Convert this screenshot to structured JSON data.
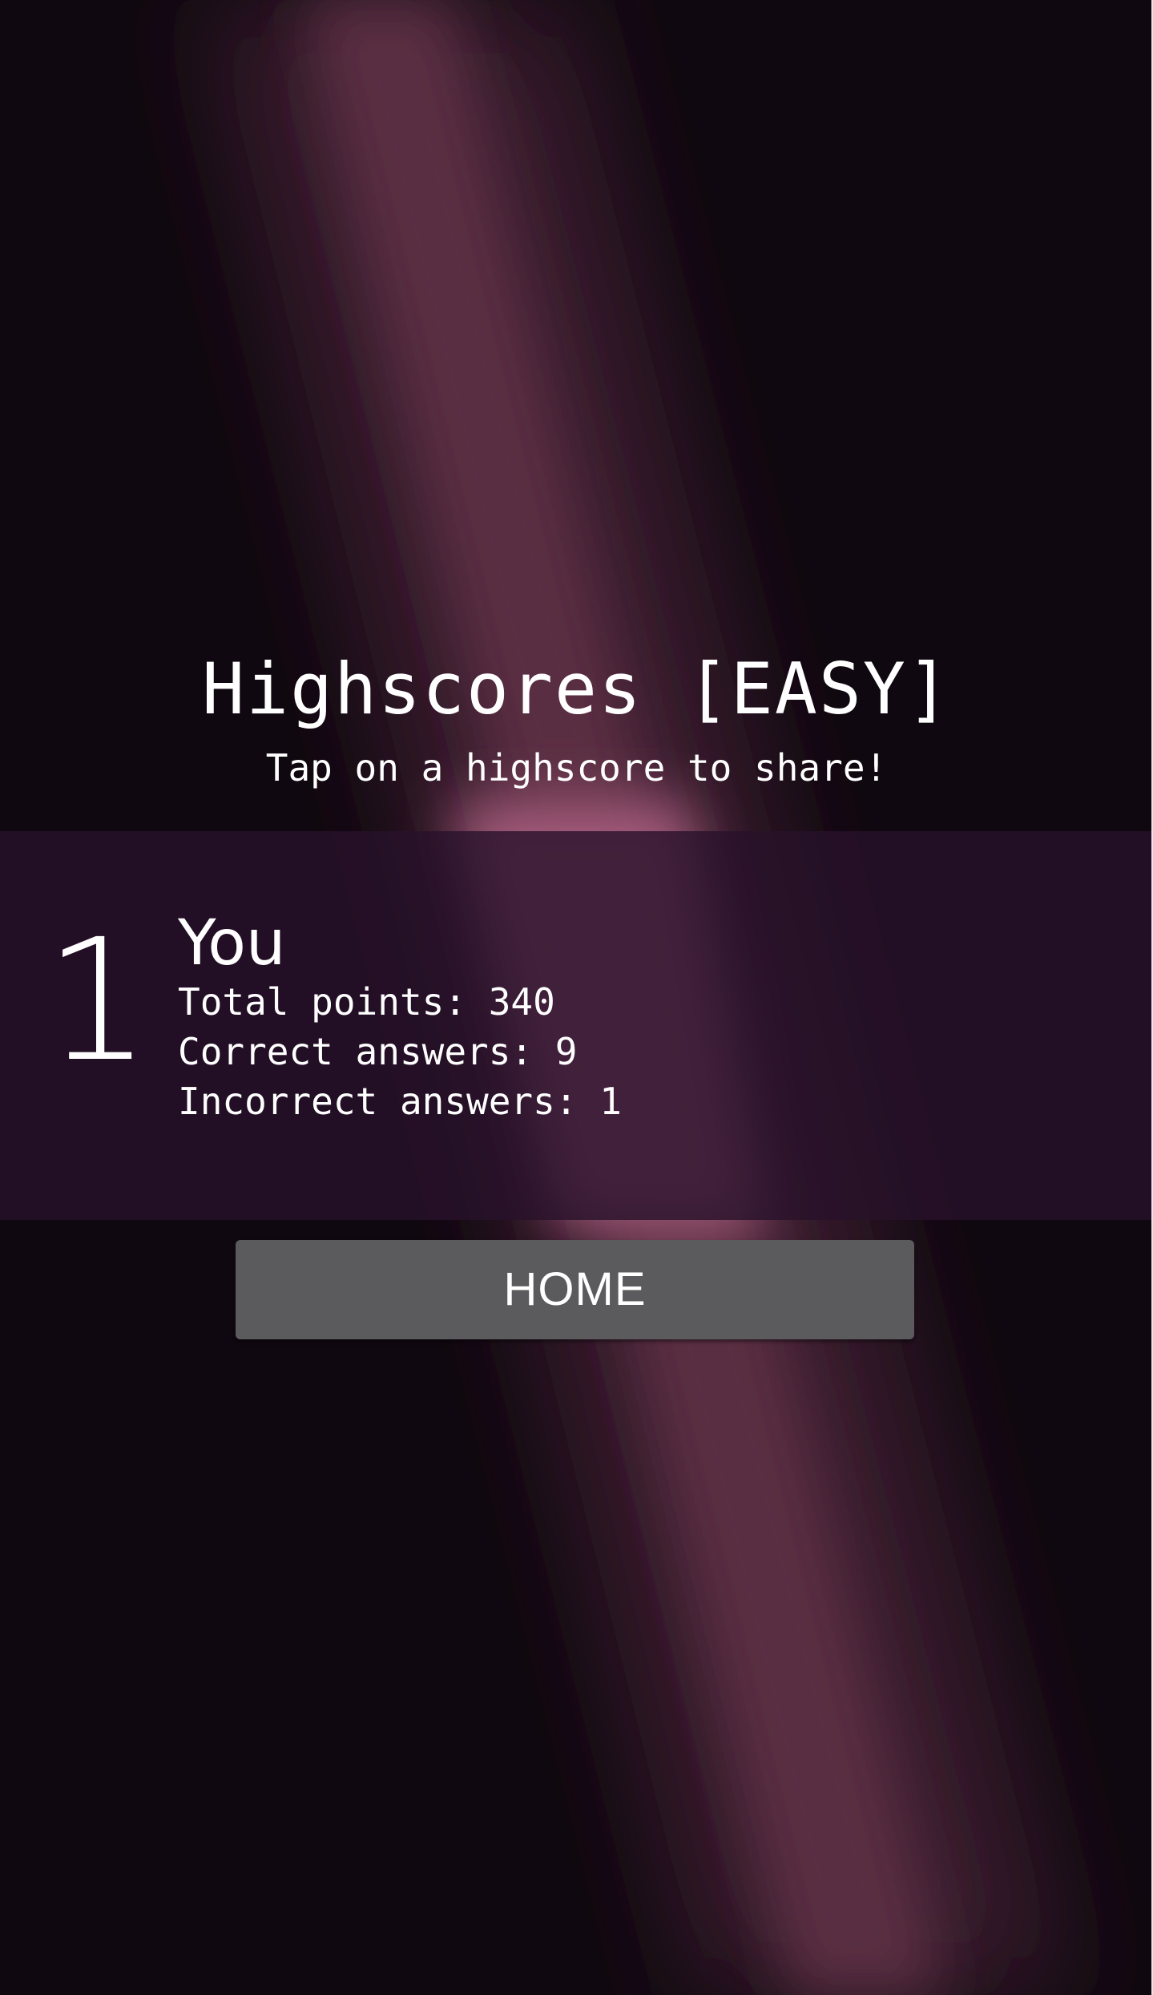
{
  "header": {
    "title": "Highscores [EASY]",
    "subtitle": "Tap on a highscore to share!"
  },
  "highscores": [
    {
      "rank": "1",
      "name": "You",
      "total_points": "Total points: 340",
      "correct_answers": "Correct answers: 9",
      "incorrect_answers": "Incorrect answers: 1"
    }
  ],
  "home_button": {
    "label": "HOME"
  },
  "colors": {
    "background": "#100810",
    "beam": "#6e3a52",
    "band": "#28122a",
    "button": "#5b5b5d",
    "text": "#ffffff"
  }
}
